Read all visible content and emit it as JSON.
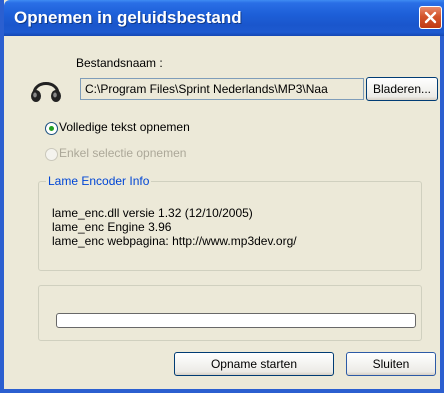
{
  "window": {
    "title": "Opnemen in geluidsbestand"
  },
  "file": {
    "label": "Bestandsnaam :",
    "path_value": "C:\\Program Files\\Sprint Nederlands\\MP3\\Naa",
    "browse_label": "Bladeren..."
  },
  "options": {
    "full_text_label": "Volledige tekst opnemen",
    "full_text_selected": true,
    "selection_label": "Enkel selectie opnemen",
    "selection_enabled": false
  },
  "encoder": {
    "group_title": "Lame Encoder Info",
    "lines": [
      "lame_enc.dll versie 1.32 (12/10/2005)",
      "lame_enc Engine 3.96",
      "lame_enc webpagina: http://www.mp3dev.org/"
    ]
  },
  "progress": {
    "fraction": 0
  },
  "buttons": {
    "start_label": "Opname starten",
    "close_label": "Sluiten"
  },
  "icons": {
    "window_close": "close-icon",
    "app": "headphones-icon"
  },
  "colors": {
    "titlebar": "#1d5fd8",
    "dialog_bg": "#ece9d8",
    "group_title": "#0046d5",
    "close_button": "#d3542c"
  }
}
